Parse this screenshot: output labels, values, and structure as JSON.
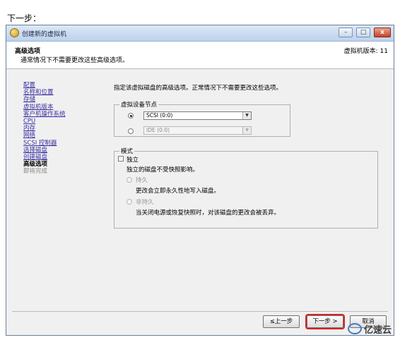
{
  "caption": "下一步：",
  "window": {
    "title": "创建新的虚拟机",
    "buttons": {
      "minimize": "–",
      "maximize": "□",
      "close": "x"
    }
  },
  "header": {
    "title": "高级选项",
    "subtitle": "通常情况下不需要更改这些高级选项。",
    "version": "虚拟机版本: 11"
  },
  "nav": {
    "items": [
      {
        "label": "配置",
        "state": "link"
      },
      {
        "label": "名称和位置",
        "state": "link"
      },
      {
        "label": "存储",
        "state": "link"
      },
      {
        "label": "虚拟机版本",
        "state": "link"
      },
      {
        "label": "客户机操作系统",
        "state": "link"
      },
      {
        "label": "CPU",
        "state": "link"
      },
      {
        "label": "内存",
        "state": "link"
      },
      {
        "label": "网络",
        "state": "link"
      },
      {
        "label": "SCSI 控制器",
        "state": "link"
      },
      {
        "label": "选择磁盘",
        "state": "link"
      },
      {
        "label": "创建磁盘",
        "state": "link"
      },
      {
        "label": "高级选项",
        "state": "current"
      },
      {
        "label": "即将完成",
        "state": "disabled"
      }
    ]
  },
  "content": {
    "description": "指定该虚拟磁盘的高级选项。正常情况下不需要更改这些选项。",
    "device_node": {
      "legend": "虚拟设备节点",
      "scsi_value": "SCSI (0:0)",
      "ide_value": "IDE (0:0)"
    },
    "mode": {
      "legend": "模式",
      "independent_label": "独立",
      "independent_desc": "独立的磁盘不受快照影响。",
      "persistent_label": "持久",
      "persistent_desc": "更改会立即永久性地写入磁盘。",
      "nonpersistent_label": "非持久",
      "nonpersistent_desc": "当关闭电源或恢复快照时，对该磁盘的更改会被丢弃。"
    }
  },
  "footer": {
    "back": "≤上一步",
    "next": "下一步 >",
    "cancel": "取消"
  },
  "watermark": "亿速云"
}
